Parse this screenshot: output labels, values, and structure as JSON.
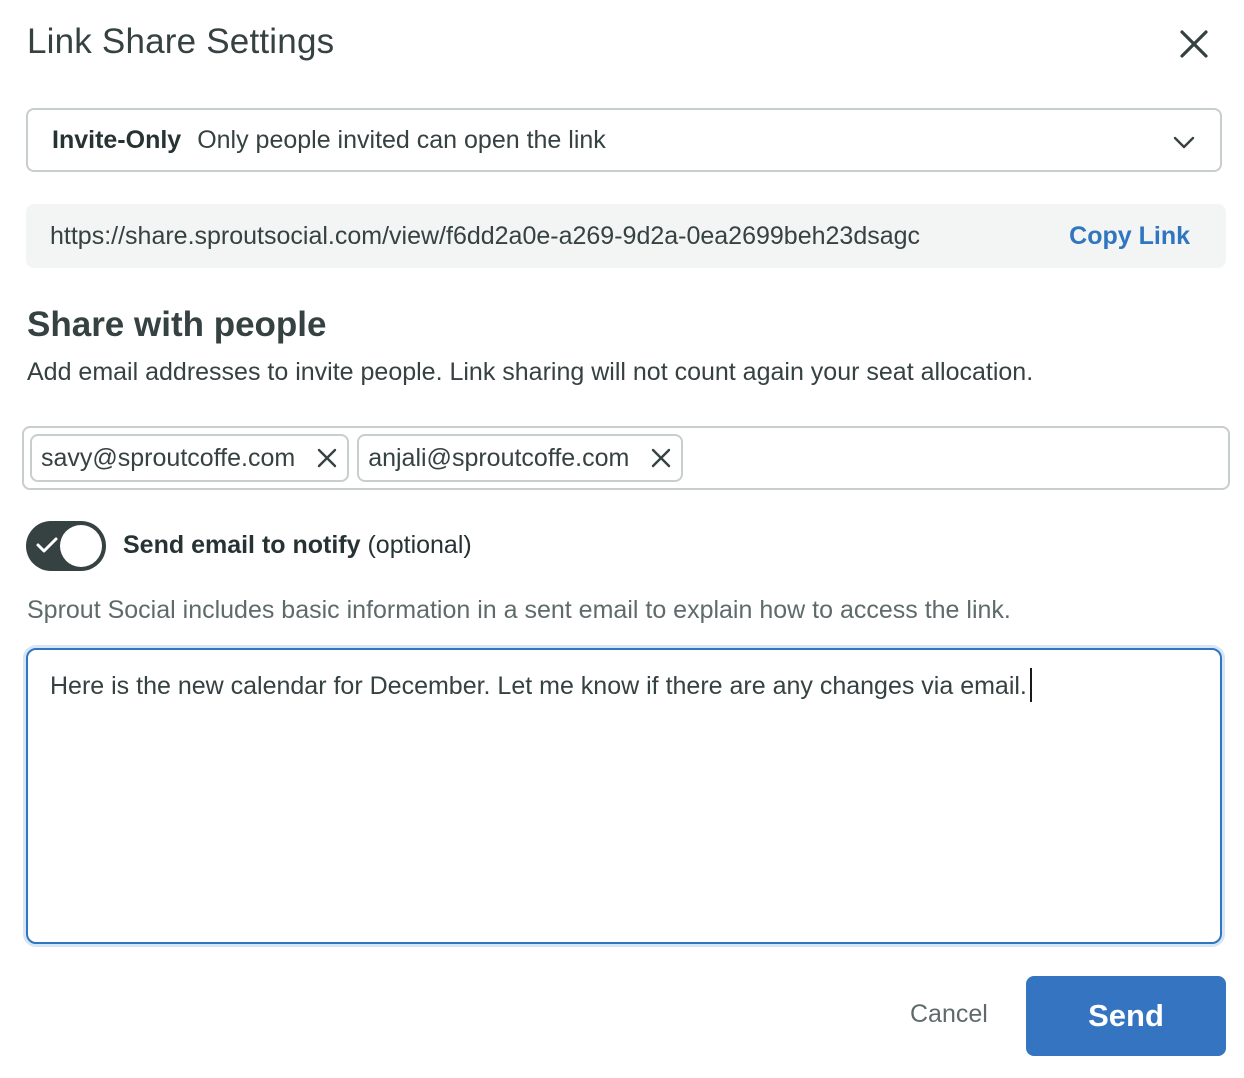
{
  "dialog": {
    "title": "Link Share Settings",
    "close_icon": "close-icon"
  },
  "access": {
    "selected_label": "Invite-Only",
    "selected_description": "Only people invited can open the link",
    "icon": "chevron-down-icon"
  },
  "link": {
    "url": "https://share.sproutsocial.com/view/f6dd2a0e-a269-9d2a-0ea2699beh23dsagc",
    "copy_label": "Copy Link"
  },
  "share": {
    "heading": "Share with people",
    "help_text": "Add email addresses to invite people. Link sharing will not count again your seat allocation.",
    "recipients": [
      "savy@sproutcoffe.com",
      "anjali@sproutcoffe.com"
    ]
  },
  "notify": {
    "enabled": true,
    "label": "Send email to notify",
    "suffix": "(optional)",
    "info": "Sprout Social includes basic information in a sent email to explain how to access the link."
  },
  "message": {
    "value": "Here is the new calendar for December. Let me know if there are any changes via email."
  },
  "footer": {
    "cancel_label": "Cancel",
    "send_label": "Send"
  },
  "colors": {
    "accent": "#3474c1",
    "link": "#2f75c0",
    "text": "#364141",
    "toggle_on": "#364141"
  }
}
